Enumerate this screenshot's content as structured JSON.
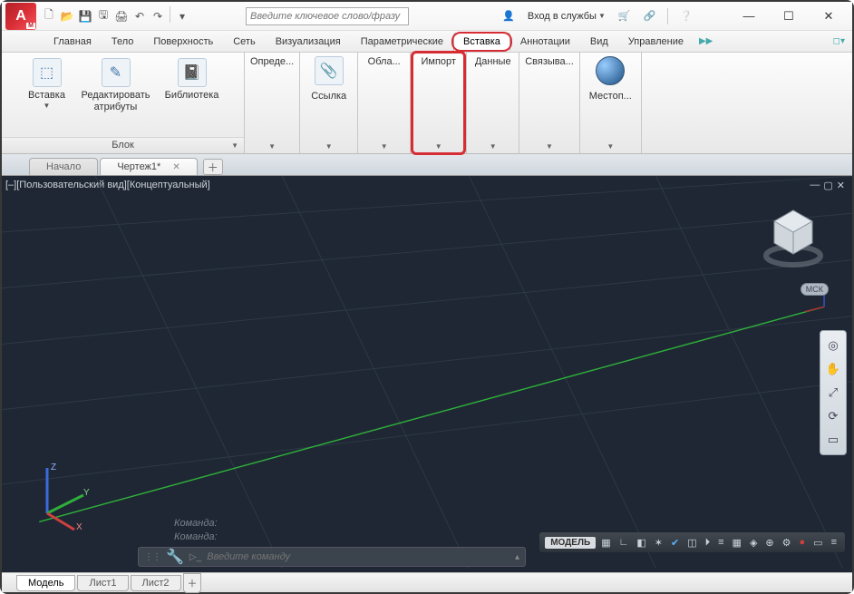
{
  "app": {
    "logo_letter": "A"
  },
  "qat": {
    "items": [
      "new",
      "open",
      "save",
      "saveas",
      "print",
      "undo",
      "redo"
    ]
  },
  "search": {
    "placeholder": "Введите ключевое слово/фразу"
  },
  "login": {
    "label": "Вход в службы"
  },
  "menu": {
    "tabs": [
      {
        "label": "Главная"
      },
      {
        "label": "Тело"
      },
      {
        "label": "Поверхность"
      },
      {
        "label": "Сеть"
      },
      {
        "label": "Визуализация"
      },
      {
        "label": "Параметрические"
      },
      {
        "label": "Вставка",
        "active": true,
        "highlight": true
      },
      {
        "label": "Аннотации"
      },
      {
        "label": "Вид"
      },
      {
        "label": "Управление"
      }
    ]
  },
  "ribbon": {
    "panels": {
      "block": {
        "title": "Блок",
        "insert": "Вставка",
        "edit_attrs_l1": "Редактировать",
        "edit_attrs_l2": "атрибуты",
        "library": "Библиотека"
      },
      "define": {
        "title": "Опреде..."
      },
      "ref": {
        "title": "Ссылка"
      },
      "cloud": {
        "title": "Обла..."
      },
      "import": {
        "title": "Импорт",
        "highlight": true
      },
      "data": {
        "title": "Данные"
      },
      "link": {
        "title": "Связыва..."
      },
      "location": {
        "title": "Местоп..."
      }
    }
  },
  "doctabs": {
    "start": "Начало",
    "drawing": "Чертеж1*"
  },
  "view": {
    "label": "[–][Пользовательский вид][Концептуальный]",
    "wcs": "МСК",
    "axes": {
      "x": "X",
      "y": "Y",
      "z": "Z"
    }
  },
  "cmd": {
    "hist1": "Команда:",
    "hist2": "Команда:",
    "placeholder": "Введите команду"
  },
  "layout": {
    "model": "Модель",
    "sheet1": "Лист1",
    "sheet2": "Лист2"
  },
  "status": {
    "model": "МОДЕЛЬ"
  }
}
